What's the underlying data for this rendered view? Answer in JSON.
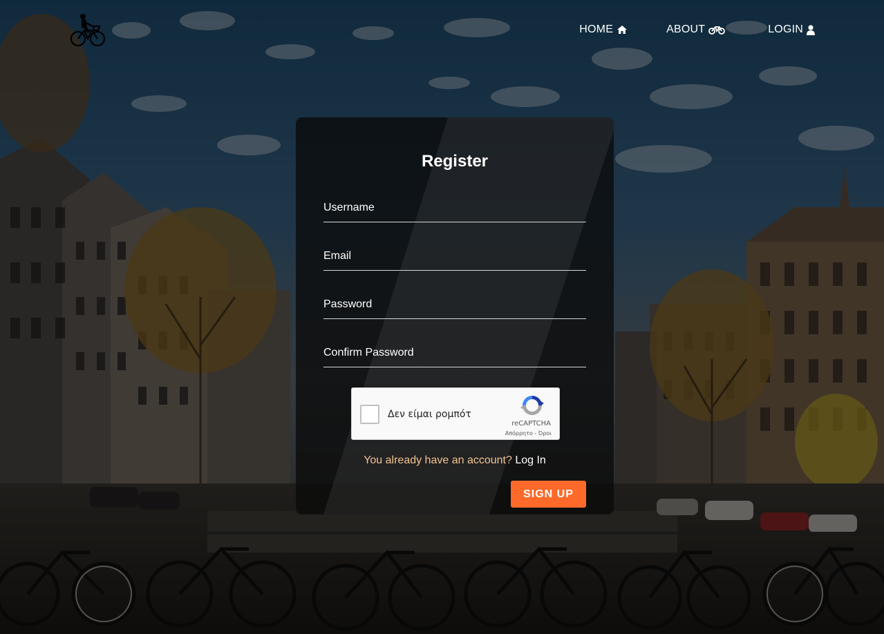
{
  "nav": {
    "logo_icon": "cyclist-icon",
    "items": [
      {
        "label": "HOME",
        "icon": "home-icon"
      },
      {
        "label": "ABOUT",
        "icon": "bicycle-icon"
      },
      {
        "label": "LOGIN",
        "icon": "user-icon"
      }
    ]
  },
  "form": {
    "title": "Register",
    "fields": [
      {
        "placeholder": "Username",
        "value": ""
      },
      {
        "placeholder": "Email",
        "value": ""
      },
      {
        "placeholder": "Password",
        "value": ""
      },
      {
        "placeholder": "Confirm Password",
        "value": ""
      }
    ],
    "recaptcha": {
      "checkbox_label": "Δεν είμαι ρομπότ",
      "brand": "reCAPTCHA",
      "terms": "Απόρρητο - Όροι"
    },
    "account_prompt": "You already have an account?",
    "login_link": "Log In",
    "submit_label": "SIGN UP"
  },
  "colors": {
    "accent": "#ff6a2a",
    "prompt_text": "#f3c48f",
    "card_bg": "rgba(10,10,10,0.78)"
  }
}
